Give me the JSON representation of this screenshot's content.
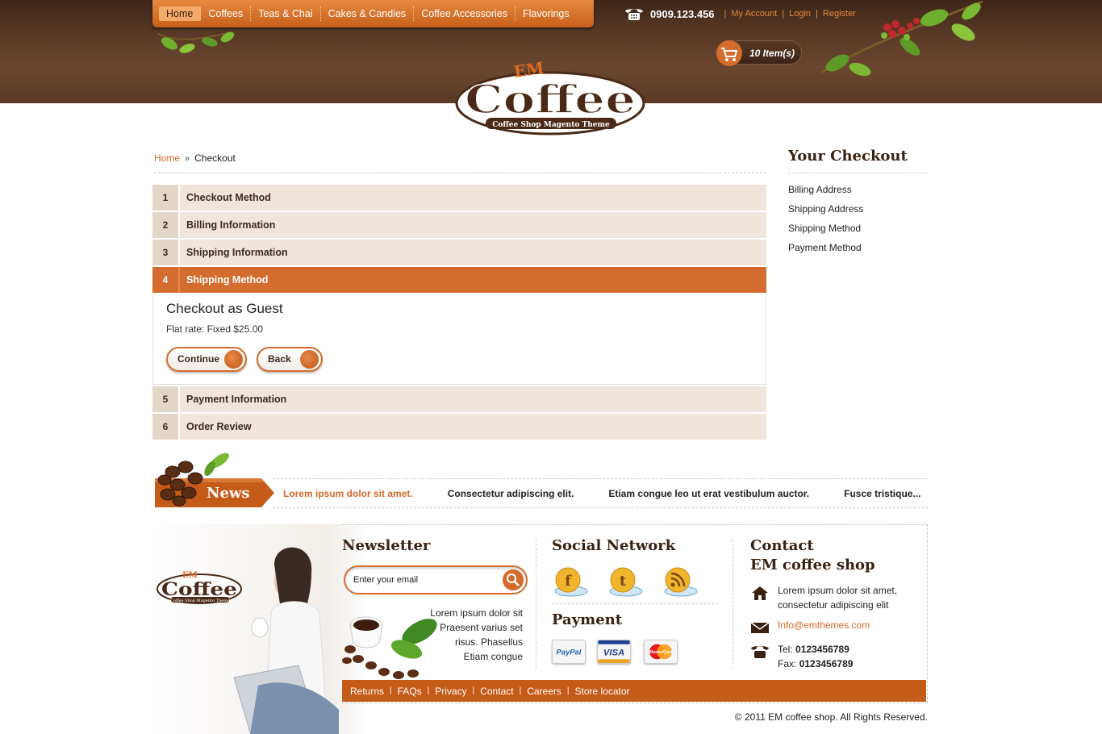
{
  "header": {
    "nav": [
      "Home",
      "Coffees",
      "Teas & Chai",
      "Cakes & Candies",
      "Coffee Accessories",
      "Flavorings"
    ],
    "phone": "0909.123.456",
    "links": [
      "My Account",
      "Login",
      "Register"
    ],
    "cart_count": "10 Item(s)"
  },
  "logo": {
    "top": "EM",
    "main": "Coffee",
    "tagline": "Coffee Shop Magento Theme"
  },
  "breadcrumb": {
    "home": "Home",
    "separator": "»",
    "current": "Checkout"
  },
  "checkout": {
    "steps": [
      {
        "num": "1",
        "title": "Checkout Method"
      },
      {
        "num": "2",
        "title": "Billing Information"
      },
      {
        "num": "3",
        "title": "Shipping Information"
      },
      {
        "num": "4",
        "title": "Shipping Method"
      },
      {
        "num": "5",
        "title": "Payment Information"
      },
      {
        "num": "6",
        "title": "Order Review"
      }
    ],
    "active_step": "4",
    "body": {
      "title": "Checkout as Guest",
      "rate": "Flat rate: Fixed $25.00",
      "continue_label": "Continue",
      "back_label": "Back"
    }
  },
  "sidebar": {
    "title": "Your Checkout",
    "items": [
      "Billing Address",
      "Shipping Address",
      "Shipping Method",
      "Payment Method"
    ]
  },
  "news": {
    "label": "News",
    "items": [
      "Lorem ipsum dolor sit amet.",
      "Consectetur adipiscing elit.",
      "Etiam congue leo ut erat vestibulum auctor.",
      "Fusce tristique..."
    ]
  },
  "footer": {
    "newsletter": {
      "title": "Newsletter",
      "placeholder": "Enter your email",
      "text": [
        "Lorem ipsum dolor sit",
        "Praesent varius set",
        "risus. Phasellus",
        "Etiam congue"
      ]
    },
    "social": {
      "title": "Social Network",
      "icons": [
        "facebook-icon",
        "twitter-icon",
        "rss-icon"
      ]
    },
    "payment": {
      "title": "Payment",
      "cards": [
        "PayPal",
        "VISA",
        "MasterCard"
      ]
    },
    "contact": {
      "title_line1": "Contact",
      "title_line2": "EM coffee shop",
      "address": [
        "Lorem ipsum dolor sit amet,",
        "consectetur adipiscing elit"
      ],
      "email": "Info@emthemes.com",
      "tel_label": "Tel:",
      "tel": "0123456789",
      "fax_label": "Fax:",
      "fax": "0123456789"
    },
    "links": [
      "Returns",
      "FAQs",
      "Privacy",
      "Contact",
      "Careers",
      "Store locator"
    ],
    "copyright": "© 2011 EM coffee shop. All Rights Reserved."
  },
  "colors": {
    "accent": "#d46c2d",
    "brown": "#3a2213",
    "step_bg": "#efe5d9"
  }
}
